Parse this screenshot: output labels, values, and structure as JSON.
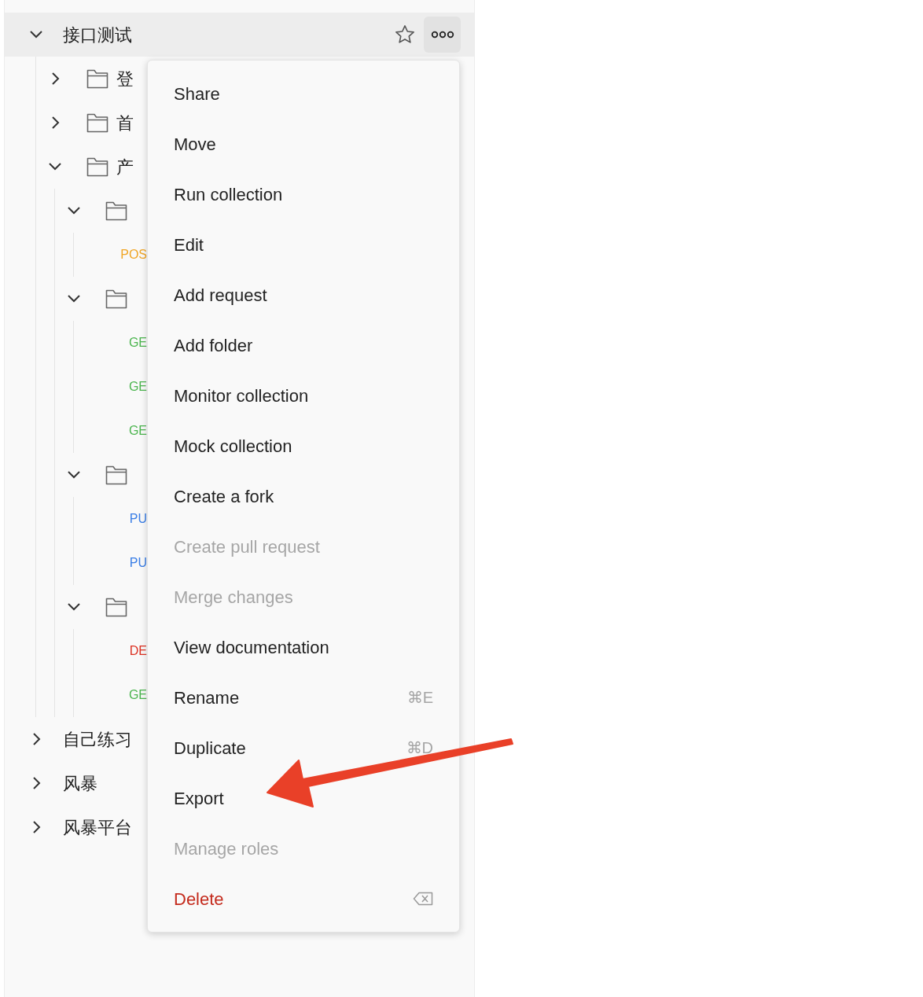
{
  "collection": {
    "name": "接口测试",
    "selected": true,
    "expanded": true,
    "starred": false,
    "children": [
      {
        "kind": "folder",
        "name": "登",
        "expanded": false
      },
      {
        "kind": "folder",
        "name": "首",
        "expanded": false
      },
      {
        "kind": "folder",
        "name": "产",
        "expanded": true,
        "children": [
          {
            "kind": "folder",
            "expanded": true,
            "children": [
              {
                "kind": "request",
                "method": "POS",
                "color": "#f0a626"
              }
            ]
          },
          {
            "kind": "folder",
            "expanded": true,
            "children": [
              {
                "kind": "request",
                "method": "GE",
                "color": "#4cb54f"
              },
              {
                "kind": "request",
                "method": "GE",
                "color": "#4cb54f"
              },
              {
                "kind": "request",
                "method": "GE",
                "color": "#4cb54f"
              }
            ]
          },
          {
            "kind": "folder",
            "expanded": true,
            "children": [
              {
                "kind": "request",
                "method": "PU",
                "color": "#3a7ee6"
              },
              {
                "kind": "request",
                "method": "PU",
                "color": "#3a7ee6"
              }
            ]
          },
          {
            "kind": "folder",
            "expanded": true,
            "children": [
              {
                "kind": "request",
                "method": "DE",
                "color": "#dc3223"
              },
              {
                "kind": "request",
                "method": "GE",
                "color": "#4cb54f"
              }
            ]
          }
        ]
      }
    ]
  },
  "other_collections": [
    {
      "name": "自己练习",
      "selected": false,
      "expanded": false
    },
    {
      "name": "风暴",
      "selected": false,
      "expanded": false
    },
    {
      "name": "风暴平台",
      "selected": false,
      "expanded": false
    }
  ],
  "context_menu": [
    {
      "label": "Share",
      "kind": "normal"
    },
    {
      "label": "Move",
      "kind": "normal"
    },
    {
      "label": "Run collection",
      "kind": "normal"
    },
    {
      "label": "Edit",
      "kind": "normal"
    },
    {
      "label": "Add request",
      "kind": "normal"
    },
    {
      "label": "Add folder",
      "kind": "normal"
    },
    {
      "label": "Monitor collection",
      "kind": "normal"
    },
    {
      "label": "Mock collection",
      "kind": "normal"
    },
    {
      "label": "Create a fork",
      "kind": "normal"
    },
    {
      "label": "Create pull request",
      "kind": "disabled"
    },
    {
      "label": "Merge changes",
      "kind": "disabled"
    },
    {
      "label": "View documentation",
      "kind": "normal"
    },
    {
      "label": "Rename",
      "kind": "normal",
      "shortcut": "⌘E"
    },
    {
      "label": "Duplicate",
      "kind": "normal",
      "shortcut": "⌘D"
    },
    {
      "label": "Export",
      "kind": "normal"
    },
    {
      "label": "Manage roles",
      "kind": "disabled"
    },
    {
      "label": "Delete",
      "kind": "danger",
      "shortcut_key_icon": true
    }
  ]
}
